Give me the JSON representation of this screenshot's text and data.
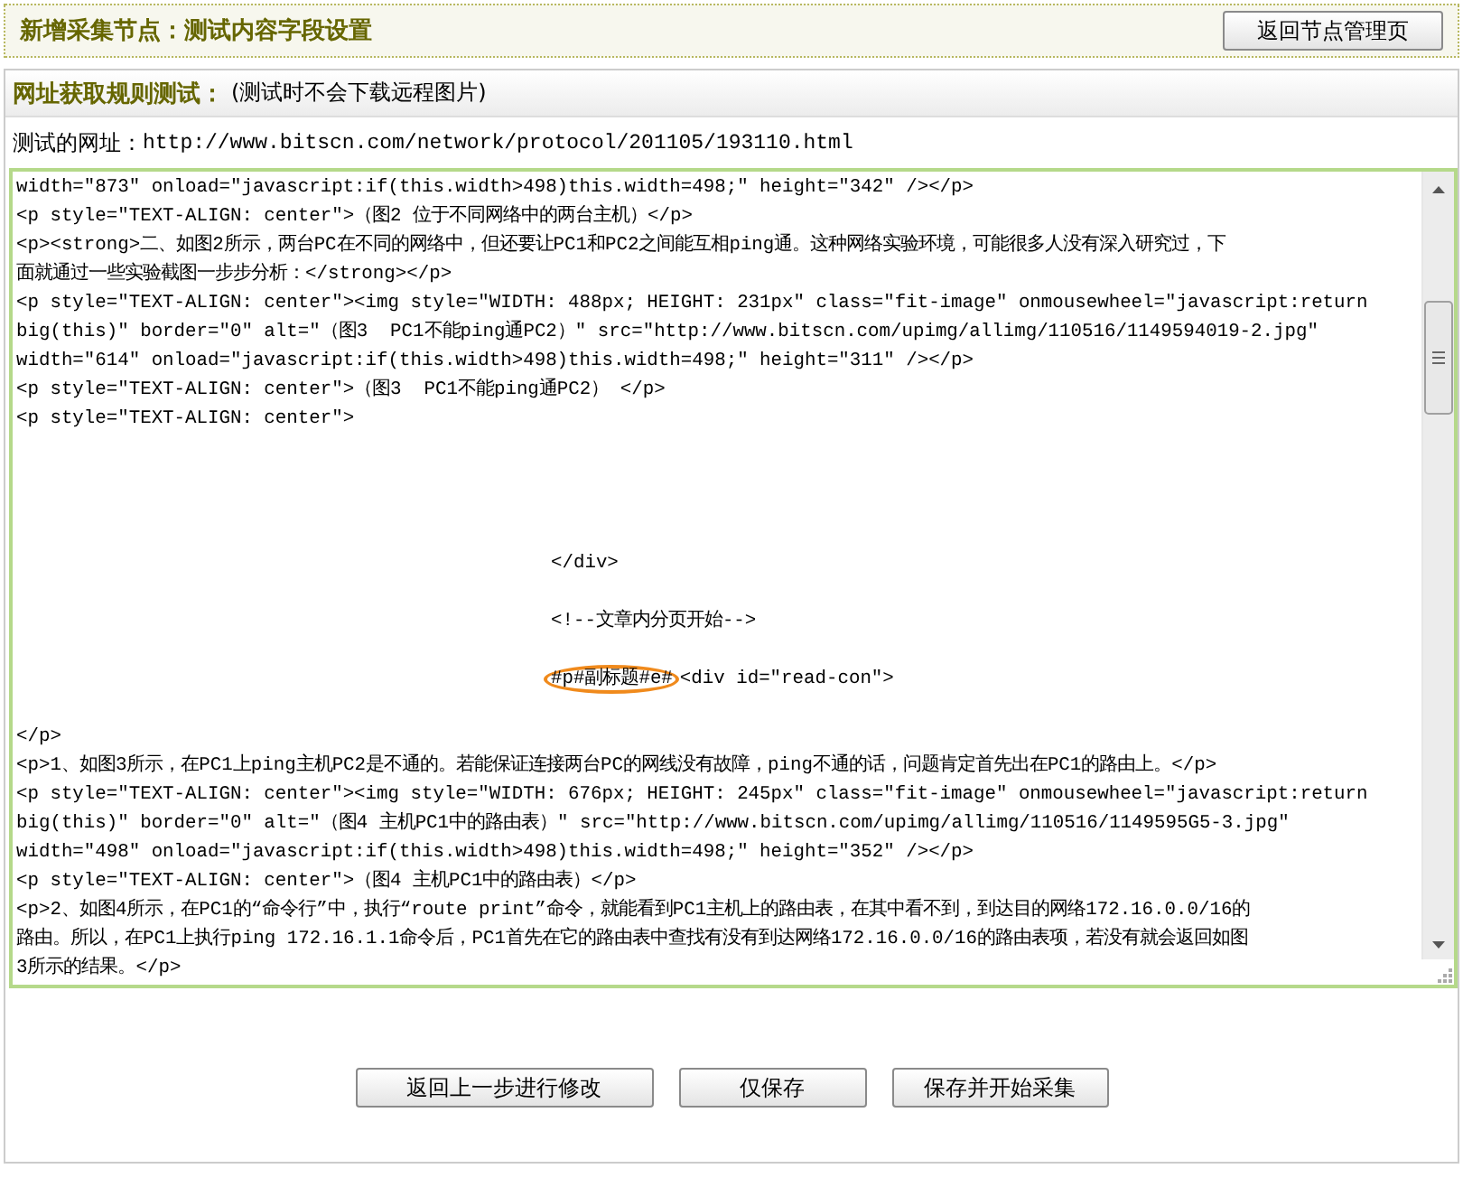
{
  "header": {
    "title": "新增采集节点：测试内容字段设置",
    "button": "返回节点管理页"
  },
  "test_panel": {
    "heading": "网址获取规则测试：",
    "note": "(测试时不会下载远程图片)",
    "url_label": "测试的网址：",
    "url": "http://www.bitscn.com/network/protocol/201105/193110.html"
  },
  "source_lines": [
    {
      "kind": "plain",
      "text": "width=\"873\" onload=\"javascript:if(this.width>498)this.width=498;\" height=\"342\" /></p>"
    },
    {
      "kind": "plain",
      "text": "<p style=\"TEXT-ALIGN: center\">（图2 位于不同网络中的两台主机）</p>"
    },
    {
      "kind": "plain",
      "text": "<p><strong>二、如图2所示，两台PC在不同的网络中，但还要让PC1和PC2之间能互相ping通。这种网络实验环境，可能很多人没有深入研究过，下"
    },
    {
      "kind": "plain",
      "text": "面就通过一些实验截图一步步分析：</strong></p>"
    },
    {
      "kind": "plain",
      "text": "<p style=\"TEXT-ALIGN: center\"><img style=\"WIDTH: 488px; HEIGHT: 231px\" class=\"fit-image\" onmousewheel=\"javascript:return"
    },
    {
      "kind": "plain",
      "text": "big(this)\" border=\"0\" alt=\"（图3  PC1不能ping通PC2）\" src=\"http://www.bitscn.com/upimg/allimg/110516/1149594019-2.jpg\""
    },
    {
      "kind": "plain",
      "text": "width=\"614\" onload=\"javascript:if(this.width>498)this.width=498;\" height=\"311\" /></p>"
    },
    {
      "kind": "plain",
      "text": "<p style=\"TEXT-ALIGN: center\">（图3  PC1不能ping通PC2） </p>"
    },
    {
      "kind": "plain",
      "text": "<p style=\"TEXT-ALIGN: center\">"
    },
    {
      "kind": "blank"
    },
    {
      "kind": "blank"
    },
    {
      "kind": "blank"
    },
    {
      "kind": "blank"
    },
    {
      "kind": "indented",
      "text": "</div>"
    },
    {
      "kind": "blank"
    },
    {
      "kind": "indented",
      "text": "<!--文章内分页开始-->"
    },
    {
      "kind": "blank"
    },
    {
      "kind": "indented",
      "circled": "#p#副标题#e#",
      "text": "<div id=\"read-con\">"
    },
    {
      "kind": "blank"
    },
    {
      "kind": "plain",
      "text": "</p>"
    },
    {
      "kind": "plain",
      "text": "<p>1、如图3所示，在PC1上ping主机PC2是不通的。若能保证连接两台PC的网线没有故障，ping不通的话，问题肯定首先出在PC1的路由上。</p>"
    },
    {
      "kind": "plain",
      "text": "<p style=\"TEXT-ALIGN: center\"><img style=\"WIDTH: 676px; HEIGHT: 245px\" class=\"fit-image\" onmousewheel=\"javascript:return"
    },
    {
      "kind": "plain",
      "text": "big(this)\" border=\"0\" alt=\"（图4 主机PC1中的路由表）\" src=\"http://www.bitscn.com/upimg/allimg/110516/1149595G5-3.jpg\""
    },
    {
      "kind": "plain",
      "text": "width=\"498\" onload=\"javascript:if(this.width>498)this.width=498;\" height=\"352\" /></p>"
    },
    {
      "kind": "plain",
      "text": "<p style=\"TEXT-ALIGN: center\">（图4 主机PC1中的路由表）</p>"
    },
    {
      "kind": "plain",
      "text": "<p>2、如图4所示，在PC1的“命令行”中，执行“route print”命令，就能看到PC1主机上的路由表，在其中看不到，到达目的网络172.16.0.0/16的"
    },
    {
      "kind": "plain",
      "text": "路由。所以，在PC1上执行ping 172.16.1.1命令后，PC1首先在它的路由表中查找有没有到达网络172.16.0.0/16的路由表项，若没有就会返回如图"
    },
    {
      "kind": "plain",
      "text": "3所示的结果。</p>"
    }
  ],
  "buttons": [
    "返回上一步进行修改",
    "仅保存",
    "保存并开始采集"
  ]
}
